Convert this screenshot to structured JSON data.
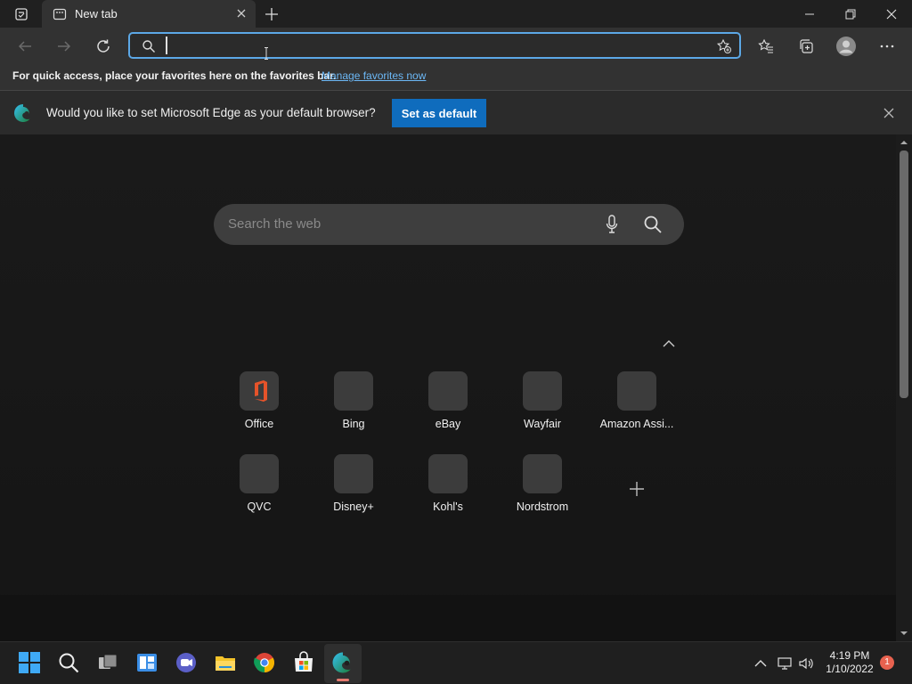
{
  "tab": {
    "title": "New tab"
  },
  "addressbar": {
    "value": "",
    "placeholder": ""
  },
  "favorites_bar": {
    "message": "For quick access, place your favorites here on the favorites bar.",
    "link": "Manage favorites now"
  },
  "infobar": {
    "message": "Would you like to set Microsoft Edge as your default browser?",
    "button": "Set as default"
  },
  "newtab": {
    "search_placeholder": "Search the web",
    "quick_links": [
      {
        "label": "Office"
      },
      {
        "label": "Bing"
      },
      {
        "label": "eBay"
      },
      {
        "label": "Wayfair"
      },
      {
        "label": "Amazon Assi..."
      },
      {
        "label": "QVC"
      },
      {
        "label": "Disney+"
      },
      {
        "label": "Kohl's"
      },
      {
        "label": "Nordstrom"
      }
    ]
  },
  "taskbar": {
    "time": "4:19 PM",
    "date": "1/10/2022",
    "notification_count": "1"
  },
  "colors": {
    "accent": "#0f6cbd",
    "focus_ring": "#5ca8e6",
    "link": "#6cb8f6",
    "badge": "#e8624f"
  }
}
